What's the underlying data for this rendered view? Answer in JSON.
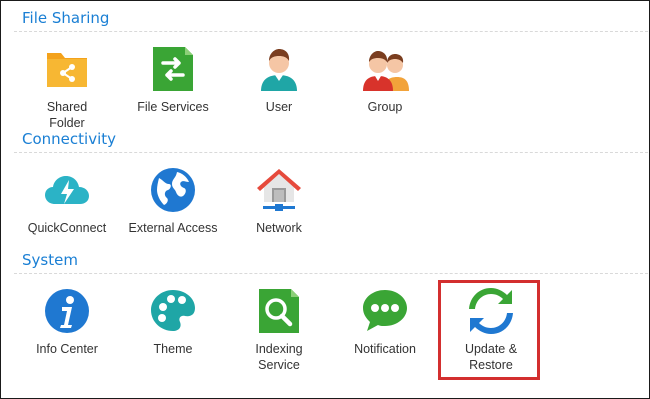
{
  "sections": {
    "file_sharing": {
      "title": "File Sharing",
      "items": [
        {
          "label": "Shared\nFolder",
          "icon": "shared-folder-icon"
        },
        {
          "label": "File Services",
          "icon": "file-services-icon"
        },
        {
          "label": "User",
          "icon": "user-icon"
        },
        {
          "label": "Group",
          "icon": "group-icon"
        }
      ]
    },
    "connectivity": {
      "title": "Connectivity",
      "items": [
        {
          "label": "QuickConnect",
          "icon": "quickconnect-icon"
        },
        {
          "label": "External Access",
          "icon": "external-access-icon"
        },
        {
          "label": "Network",
          "icon": "network-icon"
        }
      ]
    },
    "system": {
      "title": "System",
      "items": [
        {
          "label": "Info Center",
          "icon": "info-center-icon"
        },
        {
          "label": "Theme",
          "icon": "theme-icon"
        },
        {
          "label": "Indexing\nService",
          "icon": "indexing-service-icon"
        },
        {
          "label": "Notification",
          "icon": "notification-icon"
        },
        {
          "label": "Update &\nRestore",
          "icon": "update-restore-icon"
        }
      ]
    }
  },
  "colors": {
    "section_title": "#1a7fd4",
    "highlight_border": "#d32f2f"
  }
}
